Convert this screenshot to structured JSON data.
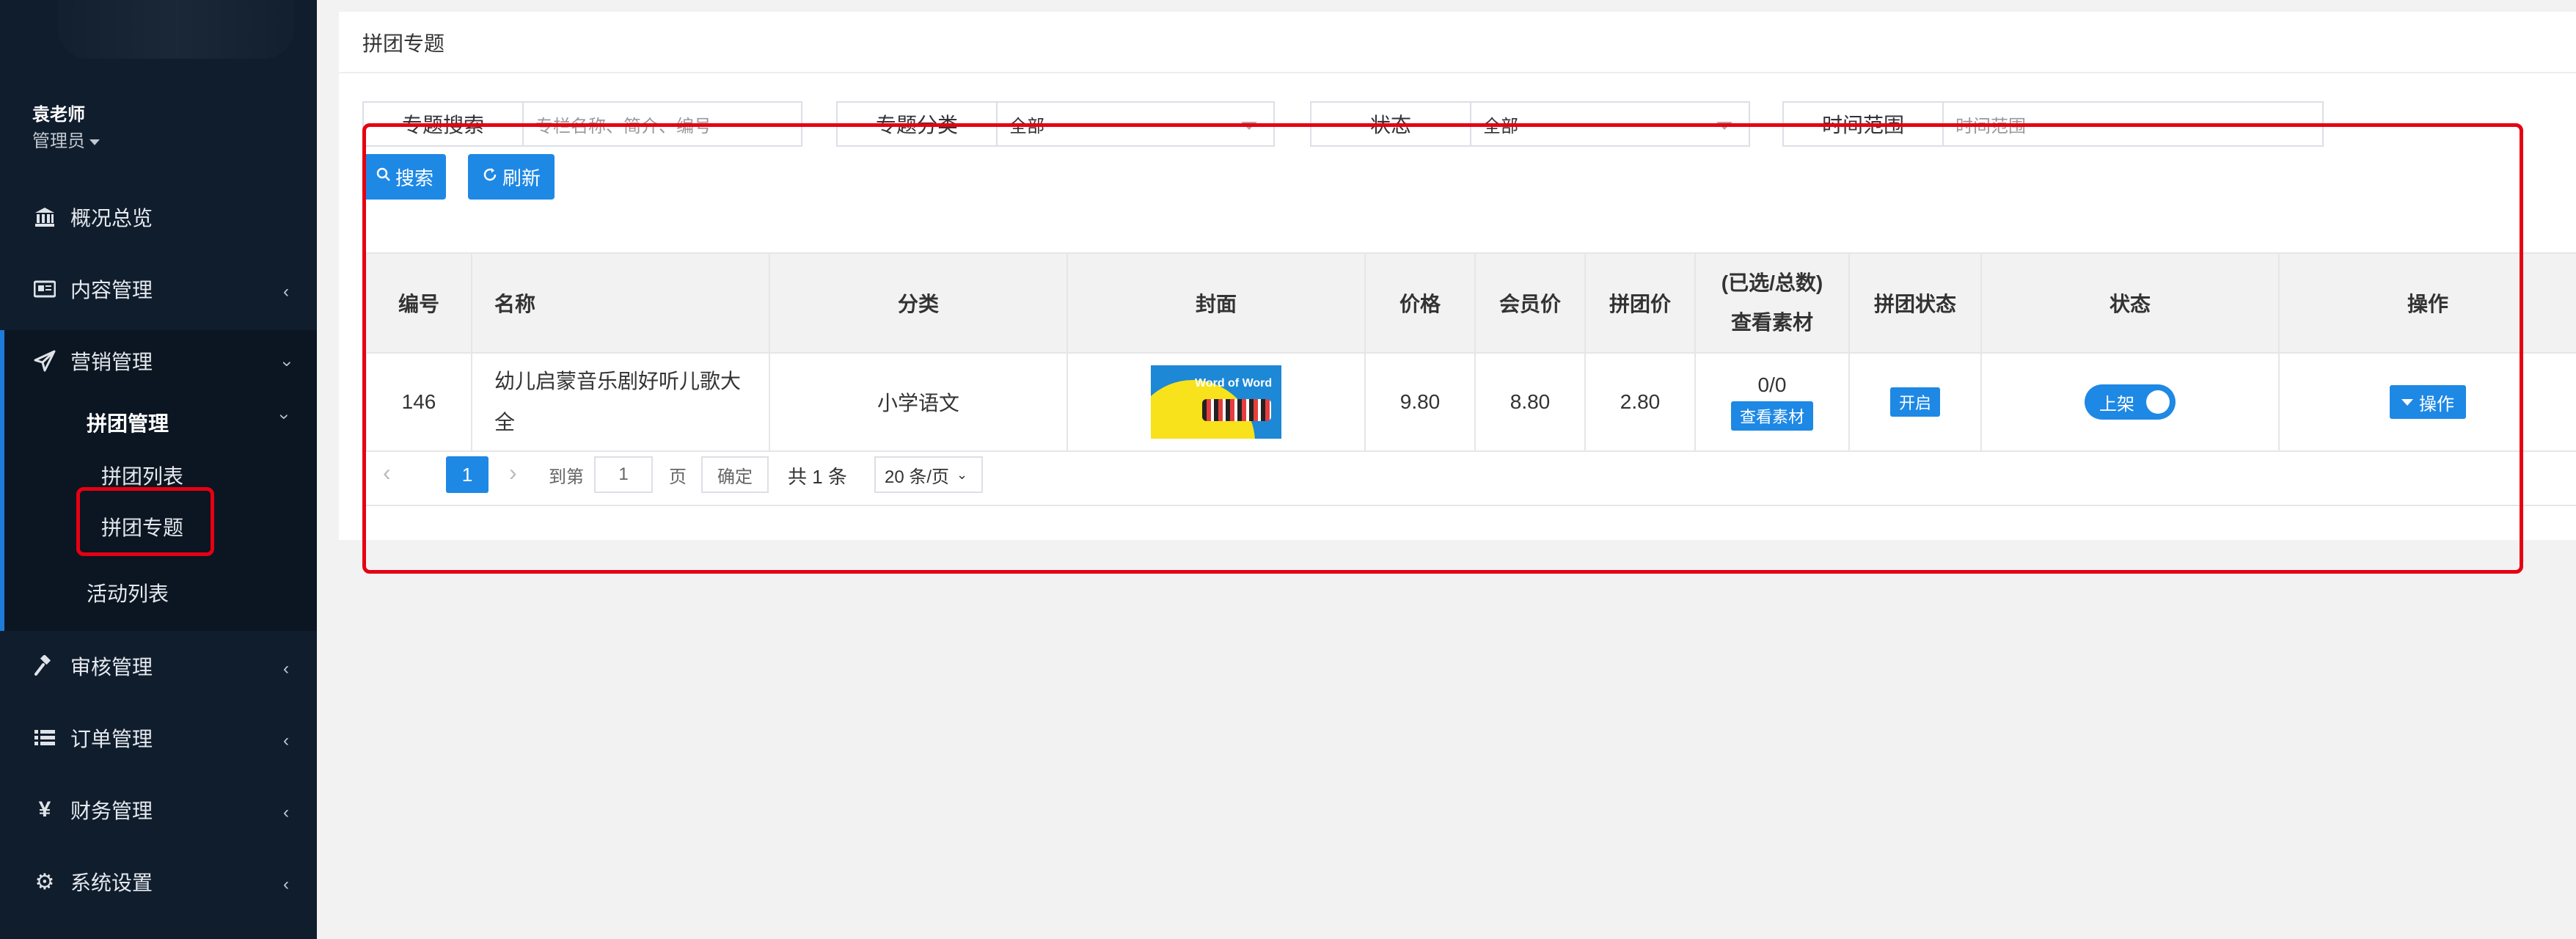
{
  "sidebar": {
    "user": {
      "name": "袁老师",
      "role": "管理员"
    },
    "items": [
      {
        "label": "概况总览",
        "icon": "bank-icon"
      },
      {
        "label": "内容管理",
        "icon": "newspaper-icon"
      },
      {
        "label": "营销管理",
        "icon": "paper-plane-icon"
      },
      {
        "label": "审核管理",
        "icon": "gavel-icon"
      },
      {
        "label": "订单管理",
        "icon": "list-icon"
      },
      {
        "label": "财务管理",
        "icon": "yen-icon"
      },
      {
        "label": "系统设置",
        "icon": "gear-icon"
      }
    ],
    "sub": {
      "group": "拼团管理",
      "list": "拼团列表",
      "topic": "拼团专题",
      "activity": "活动列表"
    }
  },
  "page": {
    "title": "拼团专题",
    "filters": {
      "search": {
        "label": "专题搜索",
        "placeholder": "专栏名称、简介、编号"
      },
      "category": {
        "label": "专题分类",
        "value": "全部"
      },
      "status": {
        "label": "状态",
        "value": "全部"
      },
      "time": {
        "label": "时间范围",
        "placeholder": "时间范围"
      }
    },
    "buttons": {
      "search": "搜索",
      "refresh": "刷新"
    },
    "table": {
      "headers": [
        "编号",
        "名称",
        "分类",
        "封面",
        "价格",
        "会员价",
        "拼团价",
        "(已选/总数)",
        "查看素材",
        "拼团状态",
        "状态",
        "操作"
      ],
      "rows": [
        {
          "id": "146",
          "name": "幼儿启蒙音乐剧好听儿歌大全",
          "category": "小学语文",
          "cover_text": "Word of Word",
          "price": "9.80",
          "member_price": "8.80",
          "group_price": "2.80",
          "selected_total": "0/0",
          "material_btn": "查看素材",
          "group_status": "开启",
          "status_toggle": "上架",
          "op_btn": "操作"
        }
      ]
    },
    "pagination": {
      "current": "1",
      "goto_label": "到第",
      "goto_value": "1",
      "page_unit": "页",
      "confirm": "确定",
      "total": "共 1 条",
      "page_size": "20 条/页"
    }
  },
  "colors": {
    "sidebar_bg": "#0f1d2d",
    "accent": "#1e88e5",
    "highlight": "#e60012"
  }
}
